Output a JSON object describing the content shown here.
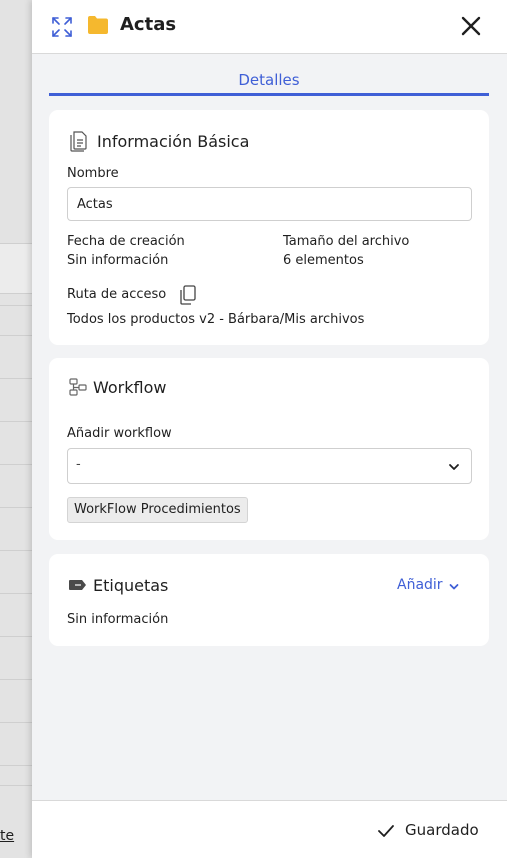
{
  "background": {
    "link_fragment": "te"
  },
  "header": {
    "title": "Actas"
  },
  "tabs": [
    {
      "label": "Detalles",
      "active": true
    }
  ],
  "basic_info": {
    "title": "Información Básica",
    "name_label": "Nombre",
    "name_value": "Actas",
    "creation_label": "Fecha de creación",
    "creation_value": "Sin información",
    "size_label": "Tamaño del archivo",
    "size_value": "6 elementos",
    "path_label": "Ruta de acceso",
    "path_value": "Todos los productos v2 - Bárbara/Mis archivos"
  },
  "workflow": {
    "title": "Workflow",
    "add_label": "Añadir workflow",
    "selected": "-",
    "chip": "WorkFlow Procedimientos"
  },
  "tags": {
    "title": "Etiquetas",
    "add_link": "Añadir",
    "empty_text": "Sin información"
  },
  "footer": {
    "status": "Guardado"
  },
  "colors": {
    "accent": "#3f5fd6",
    "folder": "#f5b82e",
    "panel_bg": "#f2f3f5"
  }
}
